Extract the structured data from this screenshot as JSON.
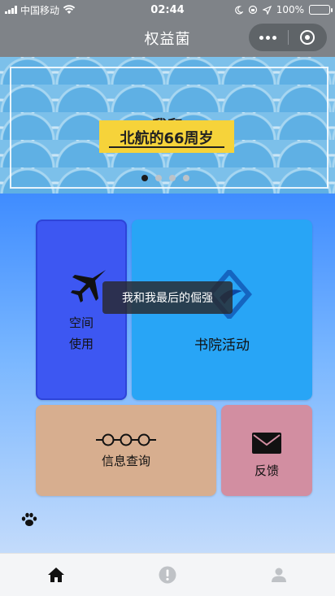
{
  "status_bar": {
    "carrier": "中国移动",
    "time": "02:44",
    "battery": "100%",
    "battery_level": 1.0
  },
  "nav": {
    "title": "权益菌"
  },
  "banner": {
    "line1": "我和",
    "line2": "北航的66周岁",
    "slide_count": 4,
    "active_slide": 1
  },
  "tiles": {
    "space": {
      "line1": "空间",
      "line2": "使用",
      "icon": "jet-icon"
    },
    "academy": {
      "label": "书院活动",
      "icon": "academy-logo-icon"
    },
    "info": {
      "label": "信息查询",
      "icon": "glasses-icon"
    },
    "feedback": {
      "label": "反馈",
      "icon": "envelope-icon"
    }
  },
  "toast": {
    "text": "我和我最后的倔强"
  },
  "tab_bar": {
    "tabs": [
      {
        "icon": "home-icon",
        "active": true
      },
      {
        "icon": "alert-icon",
        "active": false
      },
      {
        "icon": "user-icon",
        "active": false
      }
    ]
  },
  "colors": {
    "nav_bg": "#7f8388",
    "space_tile": "#3d57f2",
    "academy_tile": "#28a5f6",
    "info_tile": "#d7ae8f",
    "feedback_tile": "#d28ea1",
    "banner_highlight": "#f6d33a",
    "battery_fill": "#52d15a"
  }
}
